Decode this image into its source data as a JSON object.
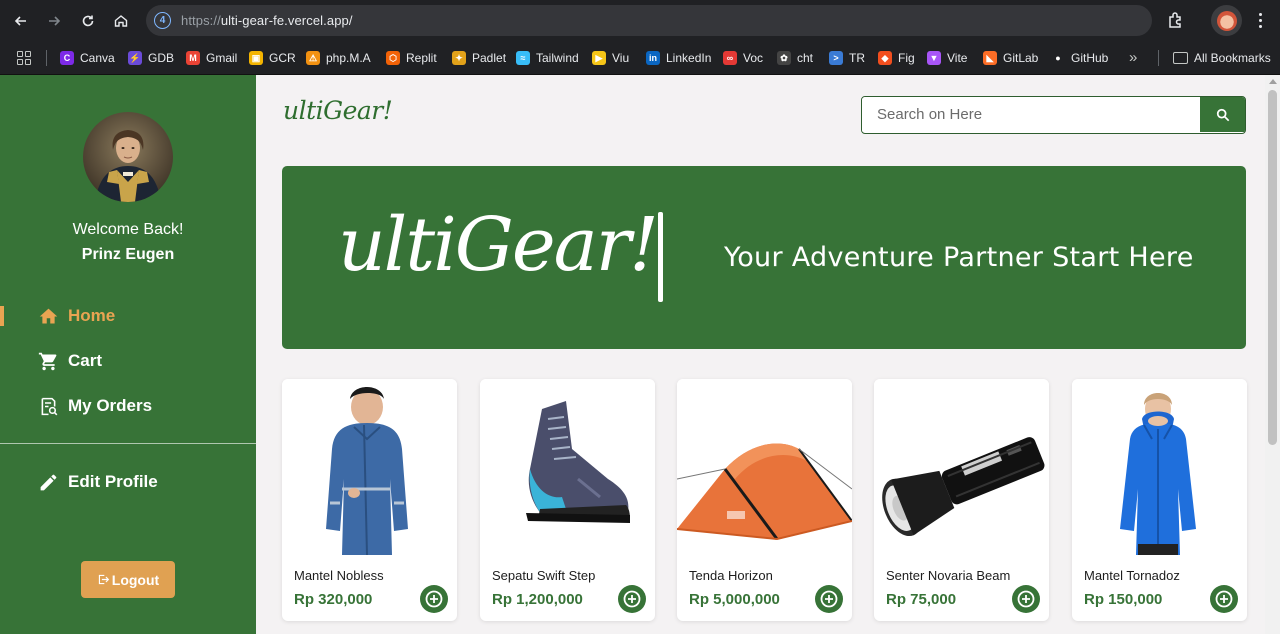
{
  "browser": {
    "url_scheme": "https://",
    "url_host": "ulti-gear-fe.vercel.app/",
    "site_icon_glyph": "4",
    "bookmarks": [
      {
        "label": "Canva",
        "color": "#7d2ae8",
        "glyph": "C"
      },
      {
        "label": "GDB",
        "color": "#6b4bd8",
        "glyph": "⚡"
      },
      {
        "label": "Gmail",
        "color": "#ea4335",
        "glyph": "M"
      },
      {
        "label": "GCR",
        "color": "#f4b400",
        "glyph": "▣"
      },
      {
        "label": "php.M.A",
        "color": "#f29111",
        "glyph": "⚠"
      },
      {
        "label": "Replit",
        "color": "#f26207",
        "glyph": "⬡"
      },
      {
        "label": "Padlet",
        "color": "#e2a21a",
        "glyph": "✦"
      },
      {
        "label": "Tailwind",
        "color": "#38bdf8",
        "glyph": "≈"
      },
      {
        "label": "Viu",
        "color": "#f5c518",
        "glyph": "▶"
      },
      {
        "label": "LinkedIn",
        "color": "#0a66c2",
        "glyph": "in"
      },
      {
        "label": "Voc",
        "color": "#e53935",
        "glyph": "∞"
      },
      {
        "label": "cht",
        "color": "#444444",
        "glyph": "✿"
      },
      {
        "label": "TR",
        "color": "#3a7bd5",
        "glyph": ">"
      },
      {
        "label": "Fig",
        "color": "#f24e1e",
        "glyph": "◆"
      },
      {
        "label": "Vite",
        "color": "#a855f7",
        "glyph": "▼"
      },
      {
        "label": "GitLab",
        "color": "#fc6d26",
        "glyph": "◣"
      },
      {
        "label": "GitHub",
        "color": "#ffffff",
        "glyph": "●"
      }
    ],
    "all_bookmarks_label": "All Bookmarks"
  },
  "sidebar": {
    "welcome": "Welcome Back!",
    "username": "Prinz Eugen",
    "menu": [
      {
        "label": "Home",
        "icon": "home-icon",
        "active": true
      },
      {
        "label": "Cart",
        "icon": "cart-icon",
        "active": false
      },
      {
        "label": "My Orders",
        "icon": "orders-icon",
        "active": false
      },
      {
        "label": "Edit Profile",
        "icon": "pencil-icon",
        "active": false
      }
    ],
    "logout_label": "Logout",
    "active_color": "#e9a452"
  },
  "header": {
    "brand": "ultiGear!",
    "search_placeholder": "Search on Here"
  },
  "banner": {
    "brand": "ultiGear!",
    "tagline": "Your Adventure Partner Start Here"
  },
  "products": [
    {
      "name": "Mantel Nobless",
      "price": "Rp 320,000",
      "image": "raincoat-image"
    },
    {
      "name": "Sepatu Swift Step",
      "price": "Rp 1,200,000",
      "image": "hiking-boot-image"
    },
    {
      "name": "Tenda Horizon",
      "price": "Rp 5,000,000",
      "image": "tent-image"
    },
    {
      "name": "Senter Novaria Beam",
      "price": "Rp 75,000",
      "image": "flashlight-image"
    },
    {
      "name": "Mantel Tornadoz",
      "price": "Rp 150,000",
      "image": "blue-jacket-image"
    }
  ],
  "colors": {
    "brand_green": "#377337",
    "accent_orange": "#e0a152",
    "page_bg": "#f4f2f3"
  }
}
